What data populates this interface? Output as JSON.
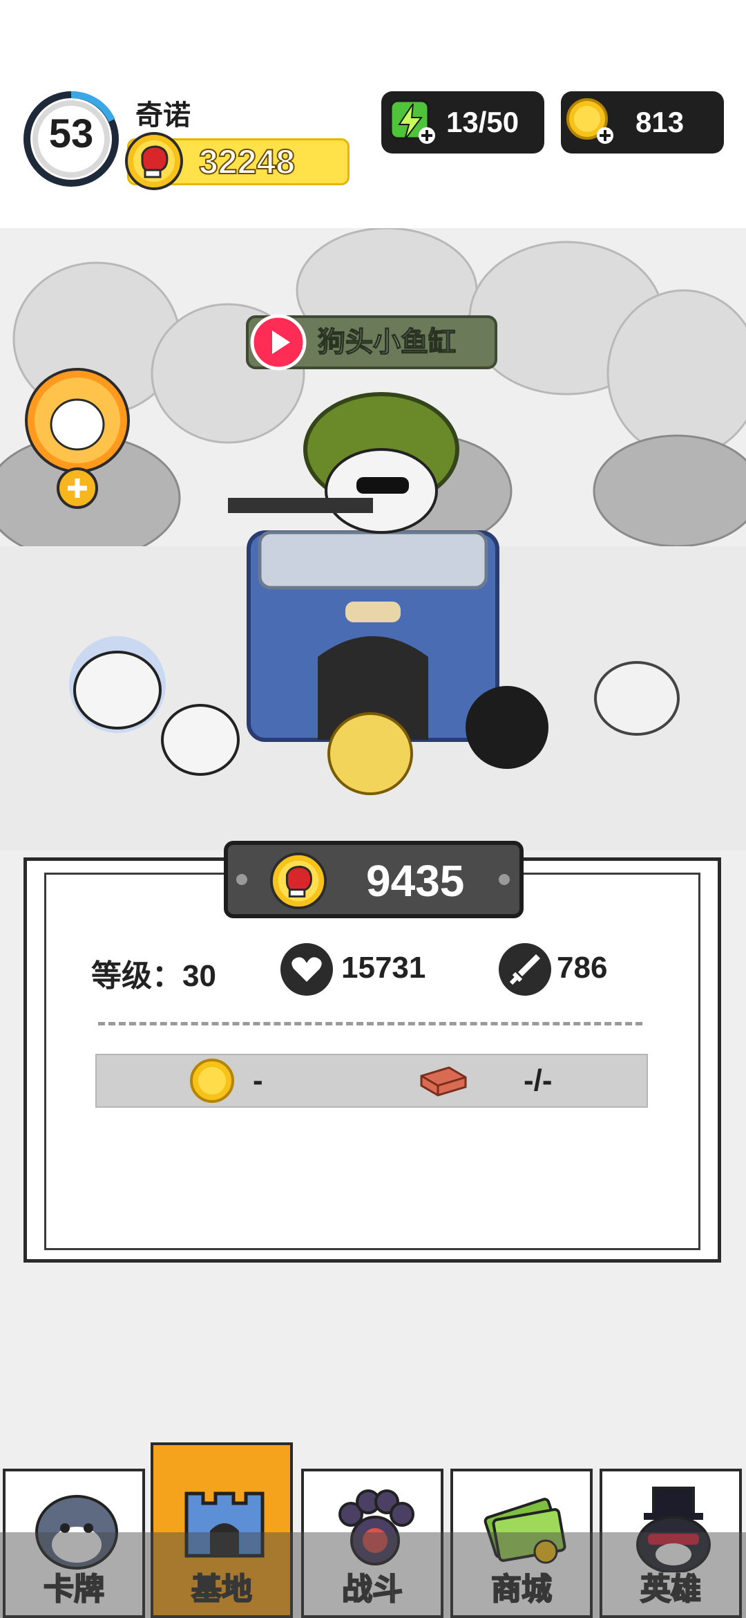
{
  "hud": {
    "level": "53",
    "level_progress": 0.3,
    "player_name": "奇诺",
    "power": "32248",
    "energy": "13/50",
    "coins": "813"
  },
  "scene": {
    "video_banner": "狗头小鱼缸"
  },
  "base_panel": {
    "gold": "9435",
    "level_label": "等级：30",
    "hp": "15731",
    "attack": "786",
    "upgrade_coin_cost": "-",
    "upgrade_brick_cost": "-/-"
  },
  "nav": {
    "tabs": [
      {
        "label": "卡牌",
        "icon": "husky-card-icon"
      },
      {
        "label": "基地",
        "icon": "castle-icon",
        "active": true
      },
      {
        "label": "战斗",
        "icon": "paw-icon"
      },
      {
        "label": "商城",
        "icon": "cash-icon"
      },
      {
        "label": "英雄",
        "icon": "top-hat-husky-icon"
      }
    ]
  },
  "colors": {
    "accent": "#f5a31c",
    "power_pill": "#ffe24a",
    "hud_dark": "#1f1f1f"
  }
}
